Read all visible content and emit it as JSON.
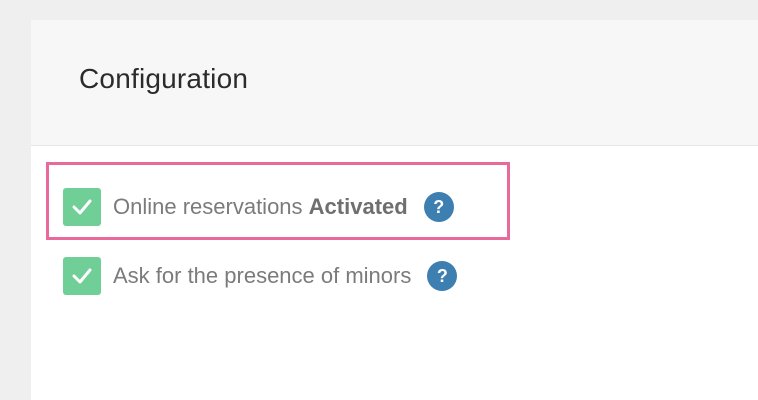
{
  "panel": {
    "title": "Configuration"
  },
  "settings": [
    {
      "label": "Online reservations",
      "emphasis": "Activated",
      "checked": true,
      "help_icon": "question-circle-icon",
      "help_glyph": "?"
    },
    {
      "label": "Ask for the presence of minors",
      "emphasis": "",
      "checked": true,
      "help_icon": "question-circle-icon",
      "help_glyph": "?"
    }
  ],
  "colors": {
    "checkbox": "#6fcf97",
    "help": "#3e7fb1",
    "highlight": "#e8699a",
    "title": "#2b2b2b",
    "label": "#7b7b7b"
  }
}
